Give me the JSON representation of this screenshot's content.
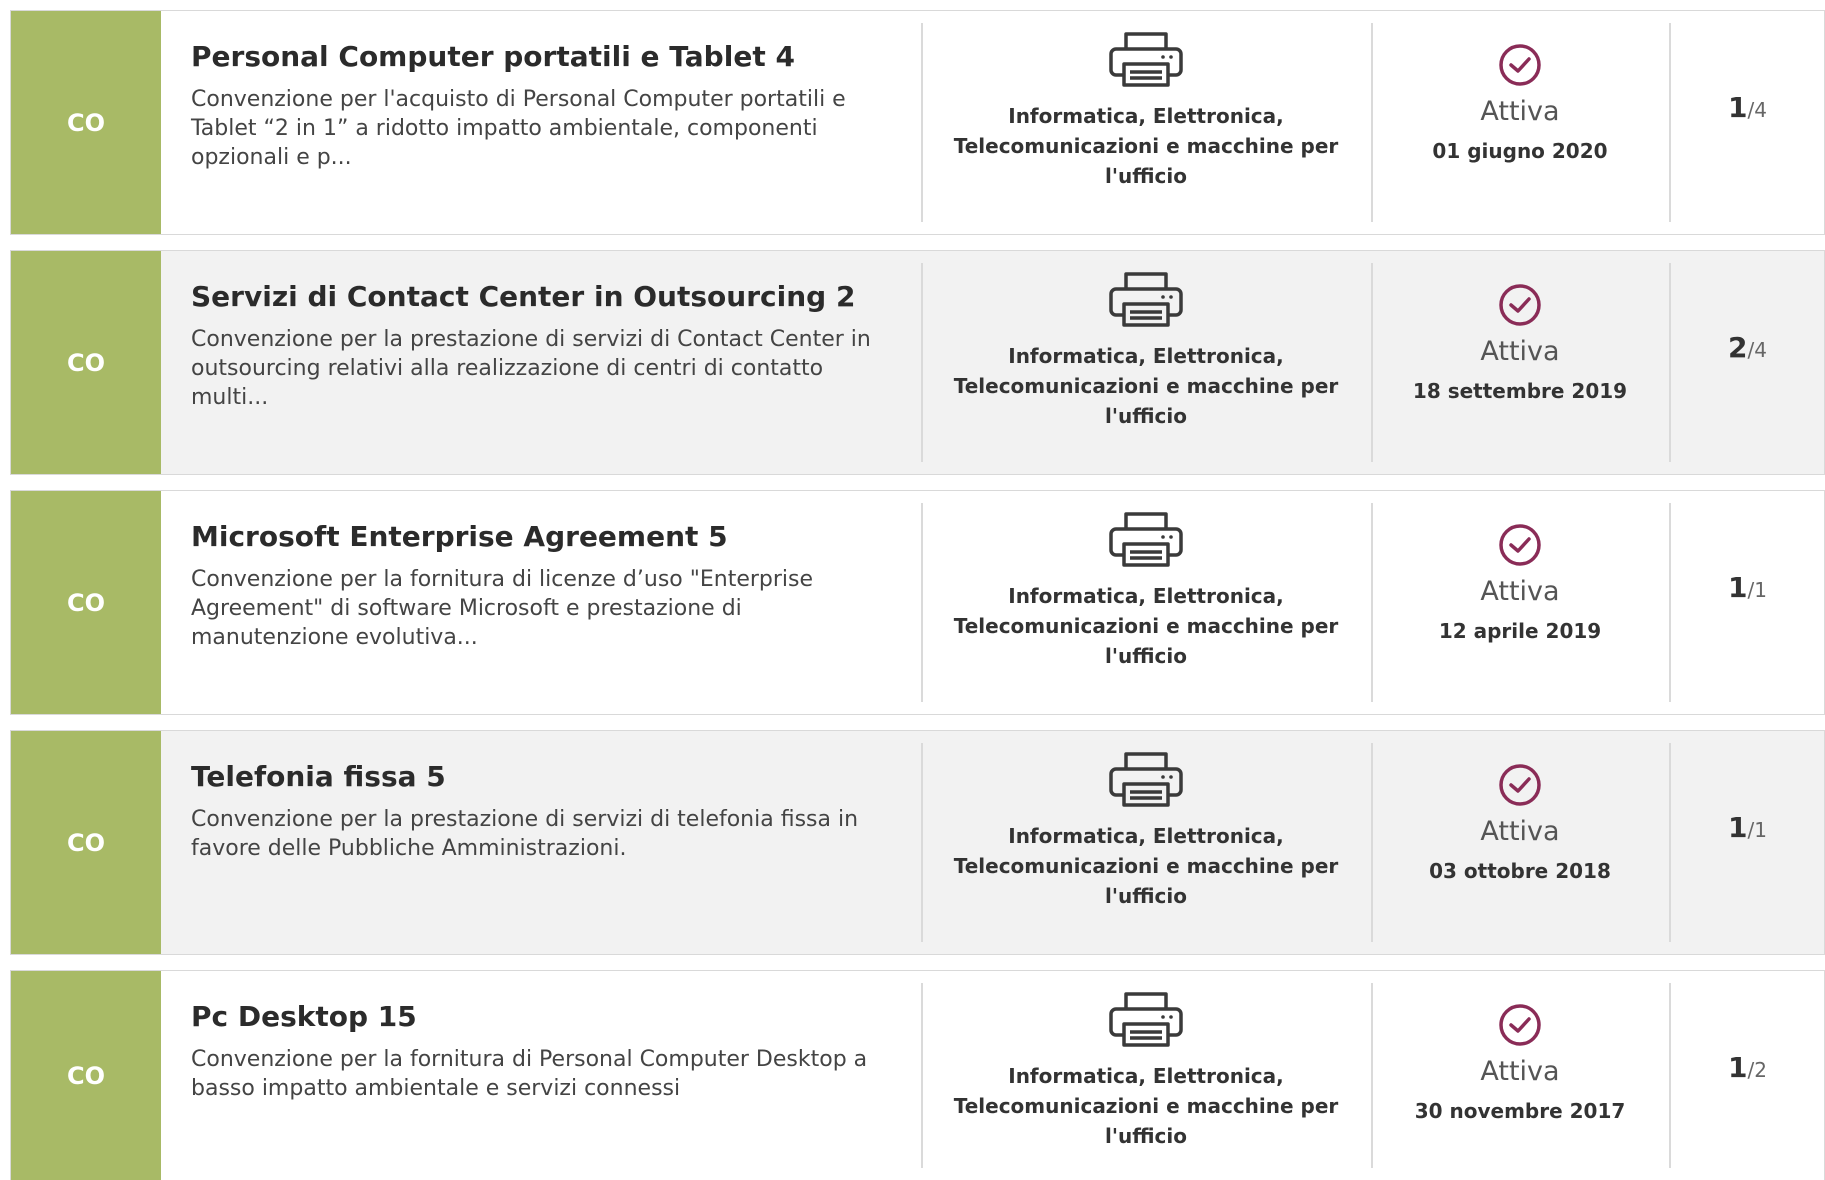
{
  "colors": {
    "badge": "#a8ba66",
    "status_icon": "#8a2c57"
  },
  "rows": [
    {
      "badge": "CO",
      "title": "Personal Computer portatili e Tablet 4",
      "description": "Convenzione per l'acquisto di Personal Computer portatili e Tablet “2 in 1” a ridotto impatto ambientale, componenti opzionali e p...",
      "category": "Informatica, Elettronica, Telecomunicazioni e macchine per l'ufficio",
      "category_icon": "printer-icon",
      "status": "Attiva",
      "status_icon": "check-circle-icon",
      "date": "01 giugno 2020",
      "count_num": "1",
      "count_den": "/4"
    },
    {
      "badge": "CO",
      "title": "Servizi di Contact Center in Outsourcing 2",
      "description": "Convenzione per la prestazione di servizi di Contact Center in outsourcing relativi alla realizzazione di centri di contatto multi...",
      "category": "Informatica, Elettronica, Telecomunicazioni e macchine per l'ufficio",
      "category_icon": "printer-icon",
      "status": "Attiva",
      "status_icon": "check-circle-icon",
      "date": "18 settembre 2019",
      "count_num": "2",
      "count_den": "/4"
    },
    {
      "badge": "CO",
      "title": "Microsoft Enterprise Agreement 5",
      "description": "Convenzione per la fornitura di licenze d’uso \"Enterprise Agreement\" di software Microsoft e prestazione di manutenzione evolutiva...",
      "category": "Informatica, Elettronica, Telecomunicazioni e macchine per l'ufficio",
      "category_icon": "printer-icon",
      "status": "Attiva",
      "status_icon": "check-circle-icon",
      "date": "12 aprile 2019",
      "count_num": "1",
      "count_den": "/1"
    },
    {
      "badge": "CO",
      "title": "Telefonia fissa 5",
      "description": "Convenzione per la prestazione di servizi di telefonia fissa in favore delle Pubbliche Amministrazioni.",
      "category": "Informatica, Elettronica, Telecomunicazioni e macchine per l'ufficio",
      "category_icon": "printer-icon",
      "status": "Attiva",
      "status_icon": "check-circle-icon",
      "date": "03 ottobre 2018",
      "count_num": "1",
      "count_den": "/1"
    },
    {
      "badge": "CO",
      "title": "Pc Desktop 15",
      "description": "Convenzione per la fornitura di Personal Computer Desktop a basso impatto ambientale e servizi connessi",
      "category": "Informatica, Elettronica, Telecomunicazioni e macchine per l'ufficio",
      "category_icon": "printer-icon",
      "status": "Attiva",
      "status_icon": "check-circle-icon",
      "date": "30 novembre 2017",
      "count_num": "1",
      "count_den": "/2"
    }
  ]
}
